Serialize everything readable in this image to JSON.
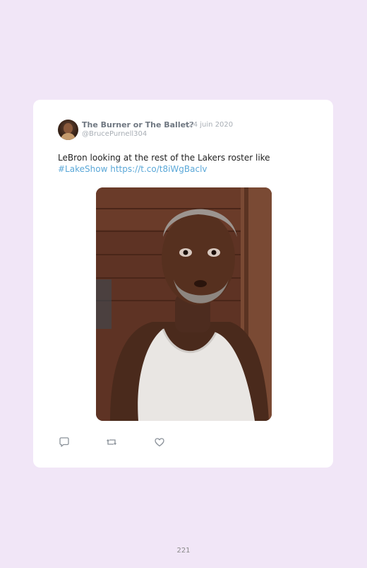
{
  "tweet": {
    "author_name": "The Burner or The Ballet?",
    "separator": "·",
    "date": "24 juin 2020",
    "handle": "@BrucePurnell304",
    "text": "LeBron looking at the rest of the Lakers roster like",
    "hashtag": "#LakeShow",
    "url": "https://t.co/t8iWgBaclv"
  },
  "icons": {
    "reply": "reply-icon",
    "retweet": "retweet-icon",
    "like": "heart-icon",
    "avatar": "avatar"
  },
  "colors": {
    "background": "#f1e6f7",
    "card": "#ffffff",
    "link": "#5ba8d8",
    "muted": "#a8aeb5"
  },
  "page": {
    "number": "221"
  }
}
